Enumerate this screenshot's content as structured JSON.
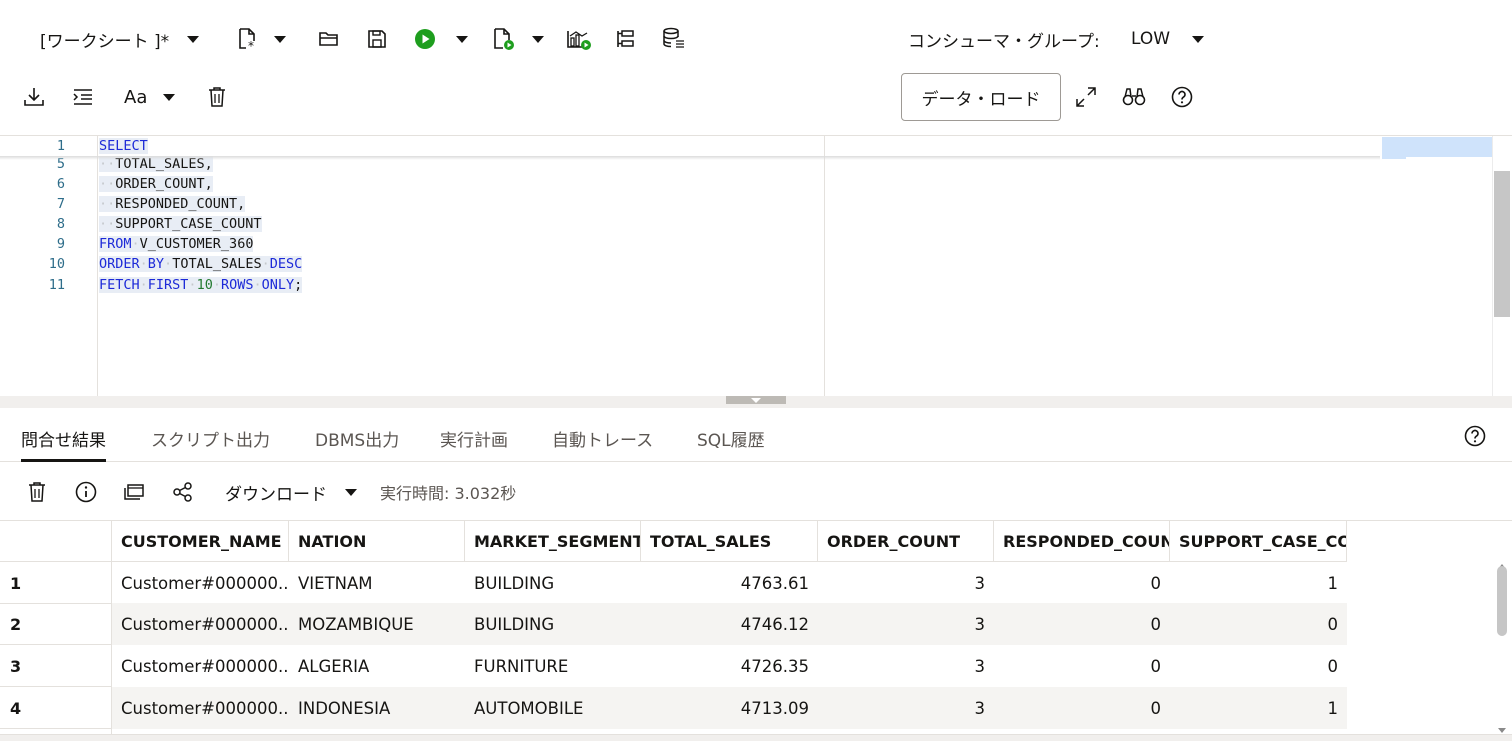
{
  "toolbar": {
    "worksheet_label": "[ワークシート ]*",
    "consumer_group_label": "コンシューマ・グループ:",
    "consumer_group_value": "LOW",
    "data_load_label": "データ・ロード",
    "font_label": "Aa",
    "icons": [
      "new-file-icon",
      "open-folder-icon",
      "save-icon",
      "run-icon",
      "run-script-icon",
      "explain-plan-icon",
      "autotrace-icon",
      "sql-history-icon",
      "download-icon",
      "format-icon",
      "font-icon",
      "delete-icon",
      "expand-icon",
      "find-icon",
      "help-icon"
    ]
  },
  "editor": {
    "lines": [
      {
        "num": "1",
        "tokens": [
          {
            "t": "SELECT",
            "c": "kw"
          }
        ]
      },
      {
        "num": "5",
        "tokens": [
          {
            "t": "··",
            "c": "dot"
          },
          {
            "t": "TOTAL_SALES,",
            "c": ""
          }
        ]
      },
      {
        "num": "6",
        "tokens": [
          {
            "t": "··",
            "c": "dot"
          },
          {
            "t": "ORDER_COUNT,",
            "c": ""
          }
        ]
      },
      {
        "num": "7",
        "tokens": [
          {
            "t": "··",
            "c": "dot"
          },
          {
            "t": "RESPONDED_COUNT,",
            "c": ""
          }
        ]
      },
      {
        "num": "8",
        "tokens": [
          {
            "t": "··",
            "c": "dot"
          },
          {
            "t": "SUPPORT_CASE_COUNT",
            "c": ""
          }
        ]
      },
      {
        "num": "9",
        "tokens": [
          {
            "t": "FROM",
            "c": "kw"
          },
          {
            "t": "·",
            "c": "dot"
          },
          {
            "t": "V_CUSTOMER_360",
            "c": ""
          }
        ]
      },
      {
        "num": "10",
        "tokens": [
          {
            "t": "ORDER",
            "c": "kw"
          },
          {
            "t": "·",
            "c": "dot"
          },
          {
            "t": "BY",
            "c": "kw"
          },
          {
            "t": "·",
            "c": "dot"
          },
          {
            "t": "TOTAL_SALES",
            "c": ""
          },
          {
            "t": "·",
            "c": "dot"
          },
          {
            "t": "DESC",
            "c": "kw"
          }
        ]
      },
      {
        "num": "11",
        "tokens": [
          {
            "t": "FETCH",
            "c": "kw"
          },
          {
            "t": "·",
            "c": "dot"
          },
          {
            "t": "FIRST",
            "c": "kw"
          },
          {
            "t": "·",
            "c": "dot"
          },
          {
            "t": "10",
            "c": "num"
          },
          {
            "t": "·",
            "c": "dot"
          },
          {
            "t": "ROWS",
            "c": "kw"
          },
          {
            "t": "·",
            "c": "dot"
          },
          {
            "t": "ONLY",
            "c": "kw"
          },
          {
            "t": ";",
            "c": ""
          }
        ]
      }
    ]
  },
  "tabs": [
    "問合せ結果",
    "スクリプト出力",
    "DBMS出力",
    "実行計画",
    "自動トレース",
    "SQL履歴"
  ],
  "results_toolbar": {
    "download_label": "ダウンロード",
    "exec_time": "実行時間: 3.032秒"
  },
  "grid": {
    "columns": [
      "CUSTOMER_NAME",
      "NATION",
      "MARKET_SEGMENT",
      "TOTAL_SALES",
      "ORDER_COUNT",
      "RESPONDED_COUNT",
      "SUPPORT_CASE_COUNT"
    ],
    "rows": [
      [
        "1",
        "Customer#000000...",
        "VIETNAM",
        "BUILDING",
        "4763.61",
        "3",
        "0",
        "1"
      ],
      [
        "2",
        "Customer#000000...",
        "MOZAMBIQUE",
        "BUILDING",
        "4746.12",
        "3",
        "0",
        "0"
      ],
      [
        "3",
        "Customer#000000...",
        "ALGERIA",
        "FURNITURE",
        "4726.35",
        "3",
        "0",
        "0"
      ],
      [
        "4",
        "Customer#000000...",
        "INDONESIA",
        "AUTOMOBILE",
        "4713.09",
        "3",
        "0",
        "1"
      ]
    ]
  }
}
